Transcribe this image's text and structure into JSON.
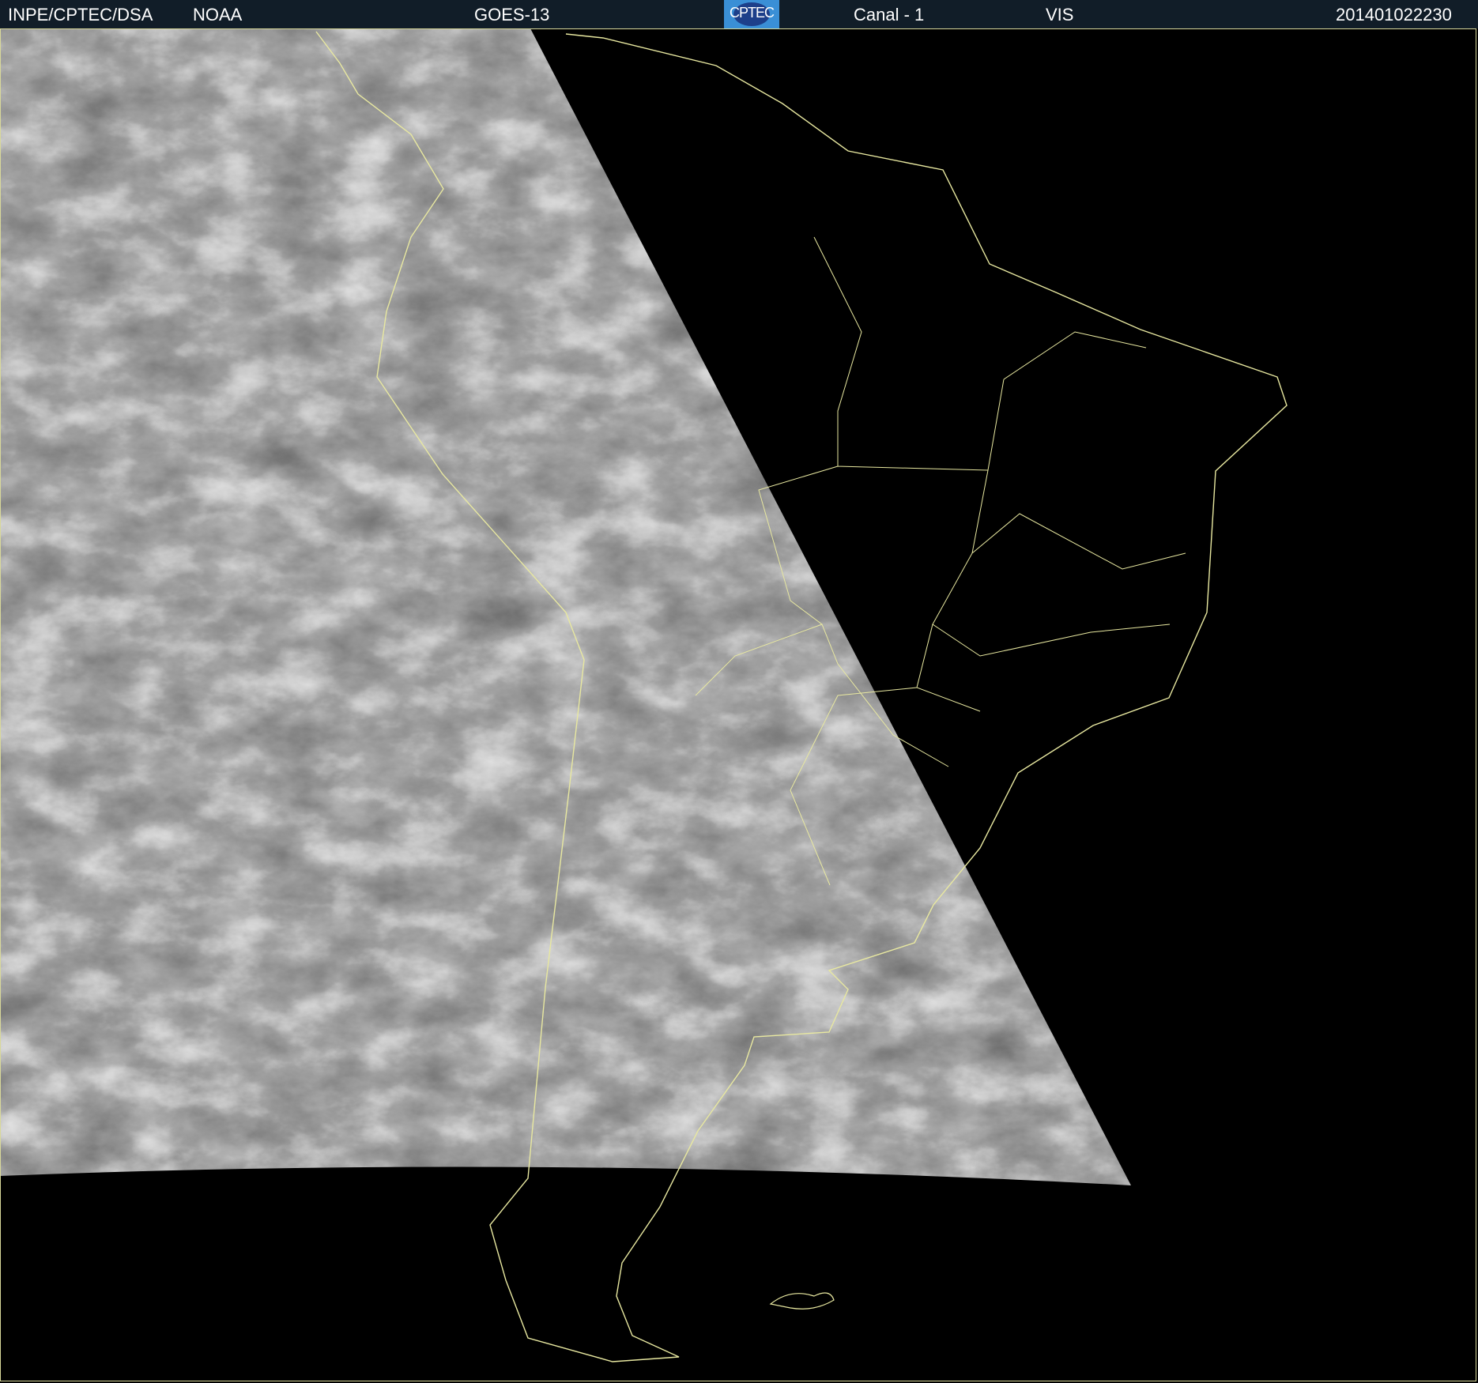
{
  "header": {
    "agency": "INPE/CPTEC/DSA",
    "source": "NOAA",
    "satellite": "GOES-13",
    "logo_text": "CPTEC",
    "channel": "Canal - 1",
    "band": "VIS",
    "timestamp": "201401022230"
  },
  "colors": {
    "header_bg": "#111d28",
    "coastline": "#e8e8a0",
    "logo_bg": "#3a8fd6"
  }
}
